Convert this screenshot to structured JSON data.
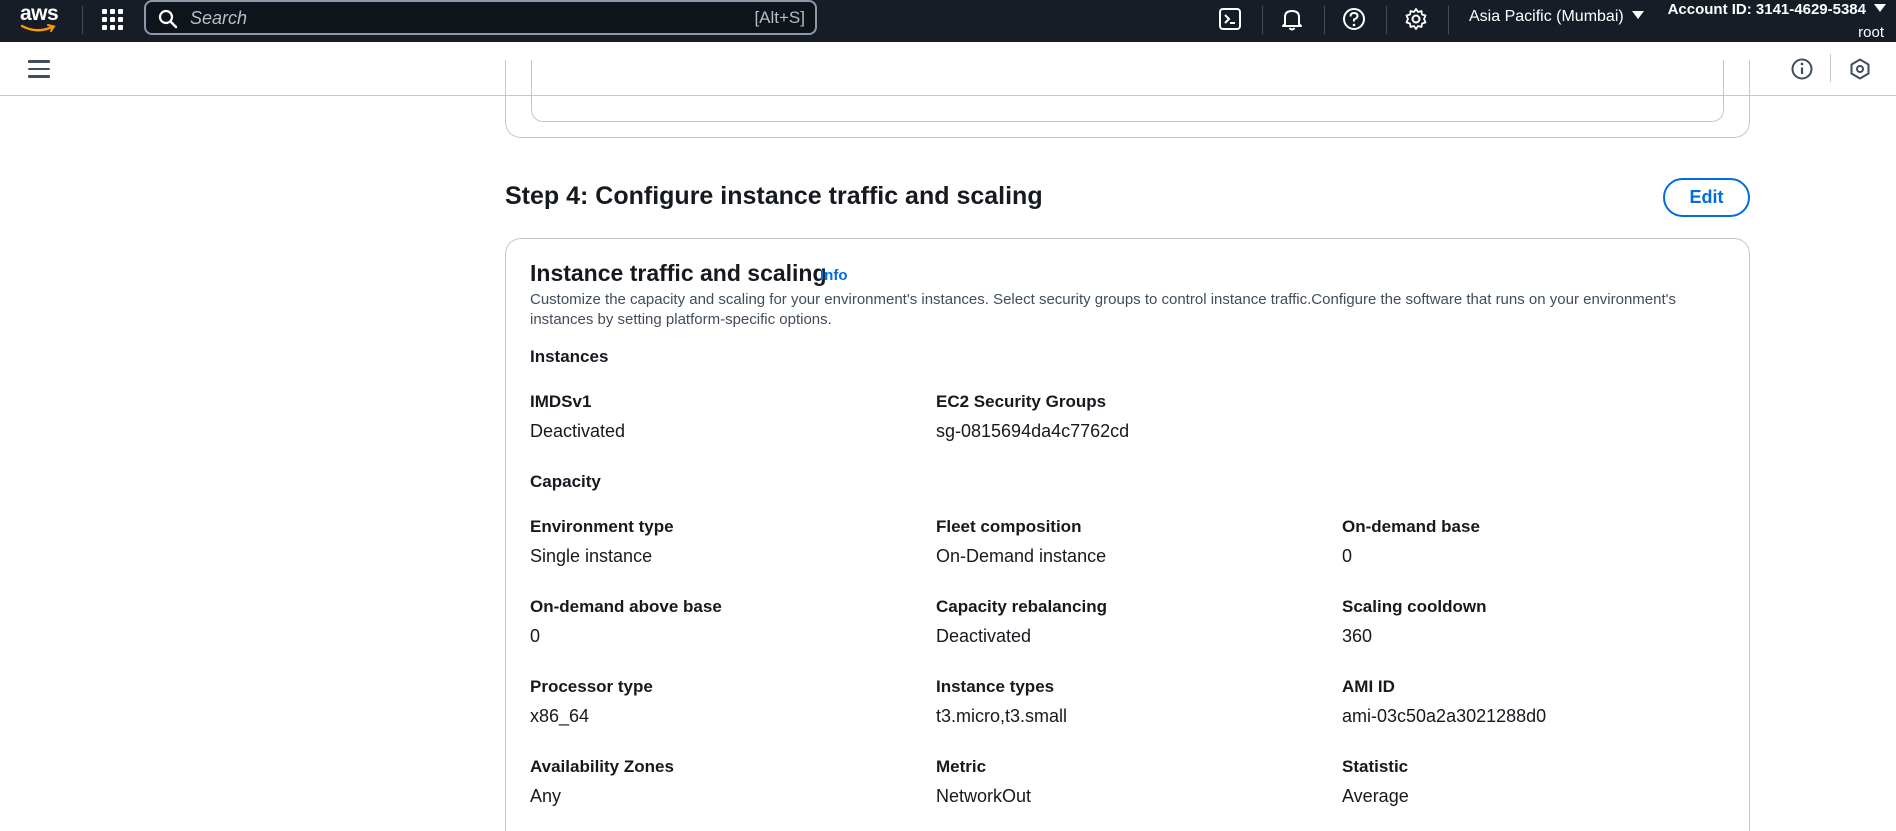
{
  "topnav": {
    "logo_text": "aws",
    "search_placeholder": "Search",
    "search_shortcut": "[Alt+S]",
    "region": "Asia Pacific (Mumbai)",
    "account": "Account ID: 3141-4629-5384",
    "user": "root"
  },
  "step": {
    "title": "Step 4: Configure instance traffic and scaling",
    "edit_label": "Edit"
  },
  "card": {
    "title": "Instance traffic and scaling",
    "info": "Info",
    "description": "Customize the capacity and scaling for your environment's instances. Select security groups to control instance traffic.Configure the software that runs on your environment's instances by setting platform-specific options.",
    "instances_heading": "Instances",
    "capacity_heading": "Capacity",
    "fields": {
      "imdsv1": {
        "label": "IMDSv1",
        "value": "Deactivated"
      },
      "ec2_sg": {
        "label": "EC2 Security Groups",
        "value": "sg-0815694da4c7762cd"
      },
      "env_type": {
        "label": "Environment type",
        "value": "Single instance"
      },
      "fleet": {
        "label": "Fleet composition",
        "value": "On-Demand instance"
      },
      "od_base": {
        "label": "On-demand base",
        "value": "0"
      },
      "od_above": {
        "label": "On-demand above base",
        "value": "0"
      },
      "rebalancing": {
        "label": "Capacity rebalancing",
        "value": "Deactivated"
      },
      "cooldown": {
        "label": "Scaling cooldown",
        "value": "360"
      },
      "processor": {
        "label": "Processor type",
        "value": "x86_64"
      },
      "instance_types": {
        "label": "Instance types",
        "value": "t3.micro,t3.small"
      },
      "ami": {
        "label": "AMI ID",
        "value": "ami-03c50a2a3021288d0"
      },
      "az": {
        "label": "Availability Zones",
        "value": "Any"
      },
      "metric": {
        "label": "Metric",
        "value": "NetworkOut"
      },
      "statistic": {
        "label": "Statistic",
        "value": "Average"
      }
    }
  }
}
